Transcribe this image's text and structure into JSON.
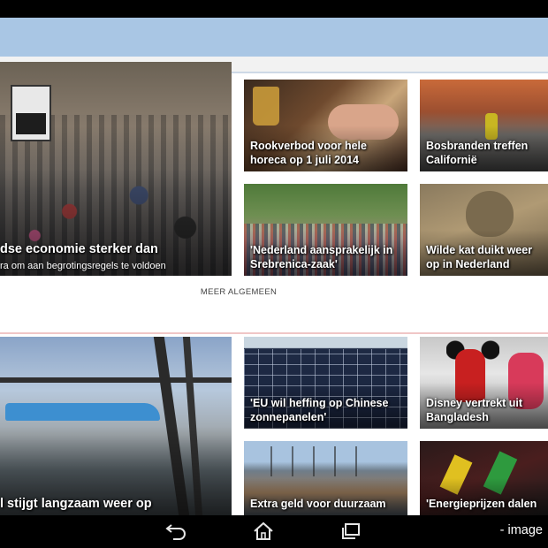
{
  "sections": {
    "algemeen": {
      "lead": {
        "title": "dse economie sterker dan",
        "subtitle": "ra om aan begrotingsregels te voldoen"
      },
      "tiles": [
        {
          "title": "Rookverbod voor hele horeca op 1 juli 2014"
        },
        {
          "title": "Bosbranden treffen Californië"
        },
        {
          "title": "'Nederland aansprakelijk in Srebrenica-zaak'"
        },
        {
          "title": "Wilde kat duikt weer op in Nederland"
        }
      ],
      "more_label": "MEER ALGEMEEN"
    },
    "economie": {
      "lead": {
        "title": "l stijgt langzaam weer op"
      },
      "tiles": [
        {
          "title": "'EU wil heffing op Chinese zonnepanelen'"
        },
        {
          "title": "Disney vertrekt uit Bangladesh"
        },
        {
          "title": "Extra geld voor duurzaam"
        },
        {
          "title": "'Energieprijzen dalen"
        }
      ]
    }
  },
  "navigation": {
    "back_icon": "back-icon",
    "home_icon": "home-icon",
    "recent_icon": "recent-apps-icon"
  },
  "watermark": "- image",
  "colors": {
    "header": "#a9c6e4",
    "section_divider": "#f0c6c6"
  }
}
